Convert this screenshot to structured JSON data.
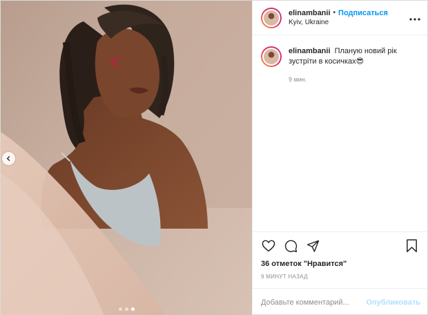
{
  "post": {
    "username": "elinambanii",
    "separator": "•",
    "follow_label": "Подписаться",
    "location": "Kyiv, Ukraine",
    "more_icon": "more-horizontal-icon"
  },
  "caption": {
    "username": "elinambanii",
    "text": "Планую новий рік зустріти в косичках😎",
    "time": "9 мин."
  },
  "media": {
    "slides_total": 3,
    "active_slide": 3,
    "prev_icon": "chevron-left-icon"
  },
  "actions": {
    "icons": [
      "heart-icon",
      "comment-icon",
      "share-icon",
      "bookmark-icon"
    ],
    "likes": "36 отметок \"Нравится\"",
    "posted_ago": "9 МИНУТ НАЗАД"
  },
  "comment_box": {
    "placeholder": "Добавьте комментарий...",
    "publish_label": "Опубликовать"
  }
}
